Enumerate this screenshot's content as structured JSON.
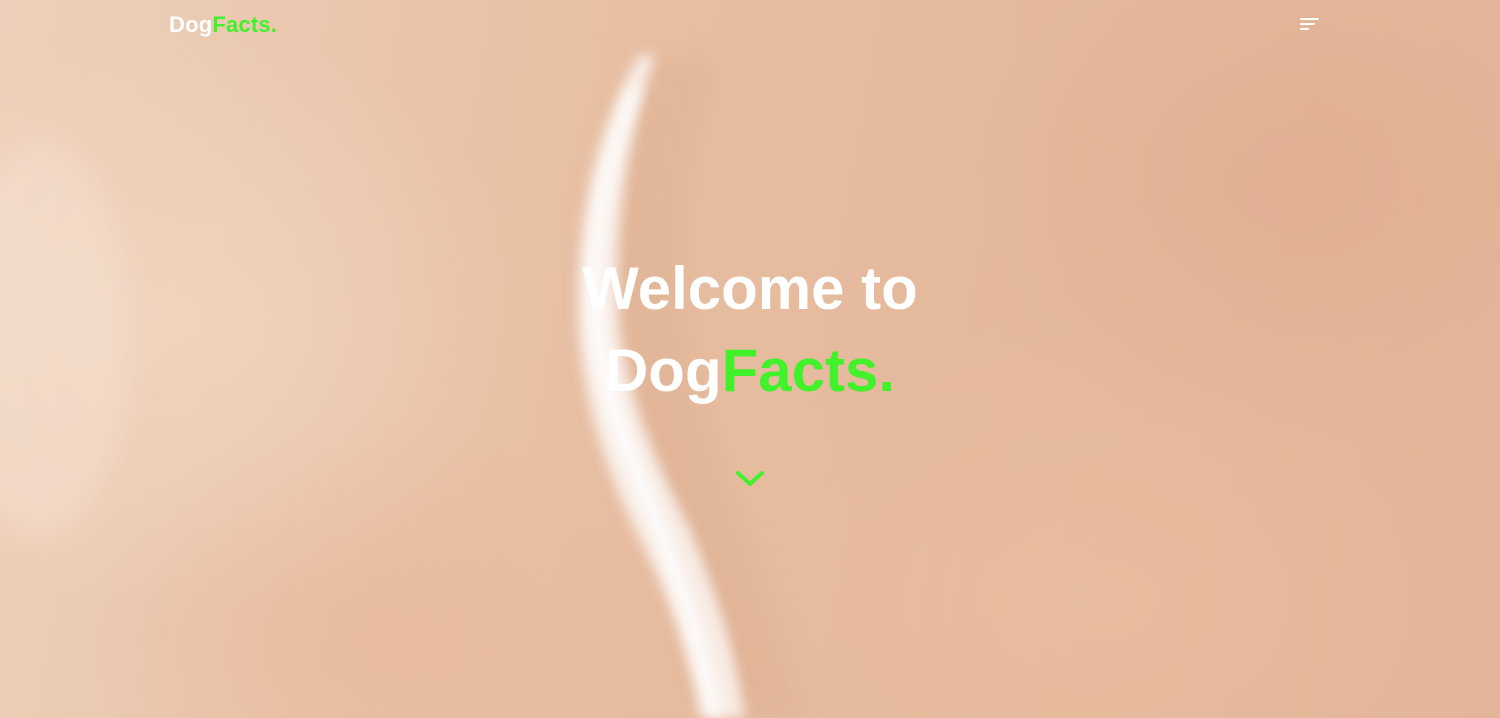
{
  "navbar": {
    "logo": {
      "part1": "Dog",
      "part2": "Facts."
    },
    "menu_icon": "hamburger-menu-icon"
  },
  "hero": {
    "line1": "Welcome to",
    "line2_part1": "Dog",
    "line2_part2": "Facts.",
    "scroll_icon": "chevron-down-icon"
  },
  "colors": {
    "accent": "#41f12a",
    "text": "#ffffff",
    "background": "#e8c3a6"
  }
}
